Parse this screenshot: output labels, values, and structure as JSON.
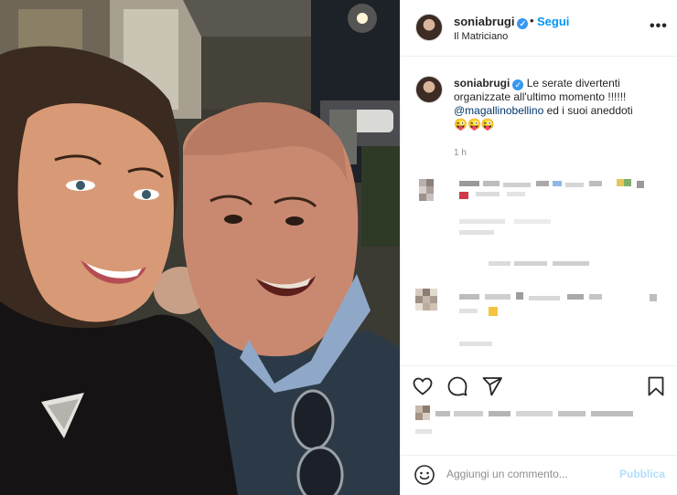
{
  "post": {
    "username": "soniabrugi",
    "follow_label": "Segui",
    "location": "Il Matriciano",
    "more_icon": "more-horizontal-icon",
    "caption": {
      "text": "Le serate divertenti organizzate all'ultimo momento !!!!!!",
      "mention": "@magallinobellino",
      "text_after": "ed i suoi aneddoti",
      "emojis": "😜😜😜",
      "time": "1 h"
    },
    "comment_count_visible": 2,
    "actions": {
      "like_icon": "heart-icon",
      "comment_icon": "comment-icon",
      "share_icon": "share-icon",
      "save_icon": "bookmark-icon"
    },
    "composer": {
      "placeholder": "Aggiungi un commento...",
      "publish_label": "Pubblica"
    }
  },
  "colors": {
    "link": "#0095f6",
    "publish_disabled": "#b2dffc",
    "verified": "#3897f0"
  }
}
